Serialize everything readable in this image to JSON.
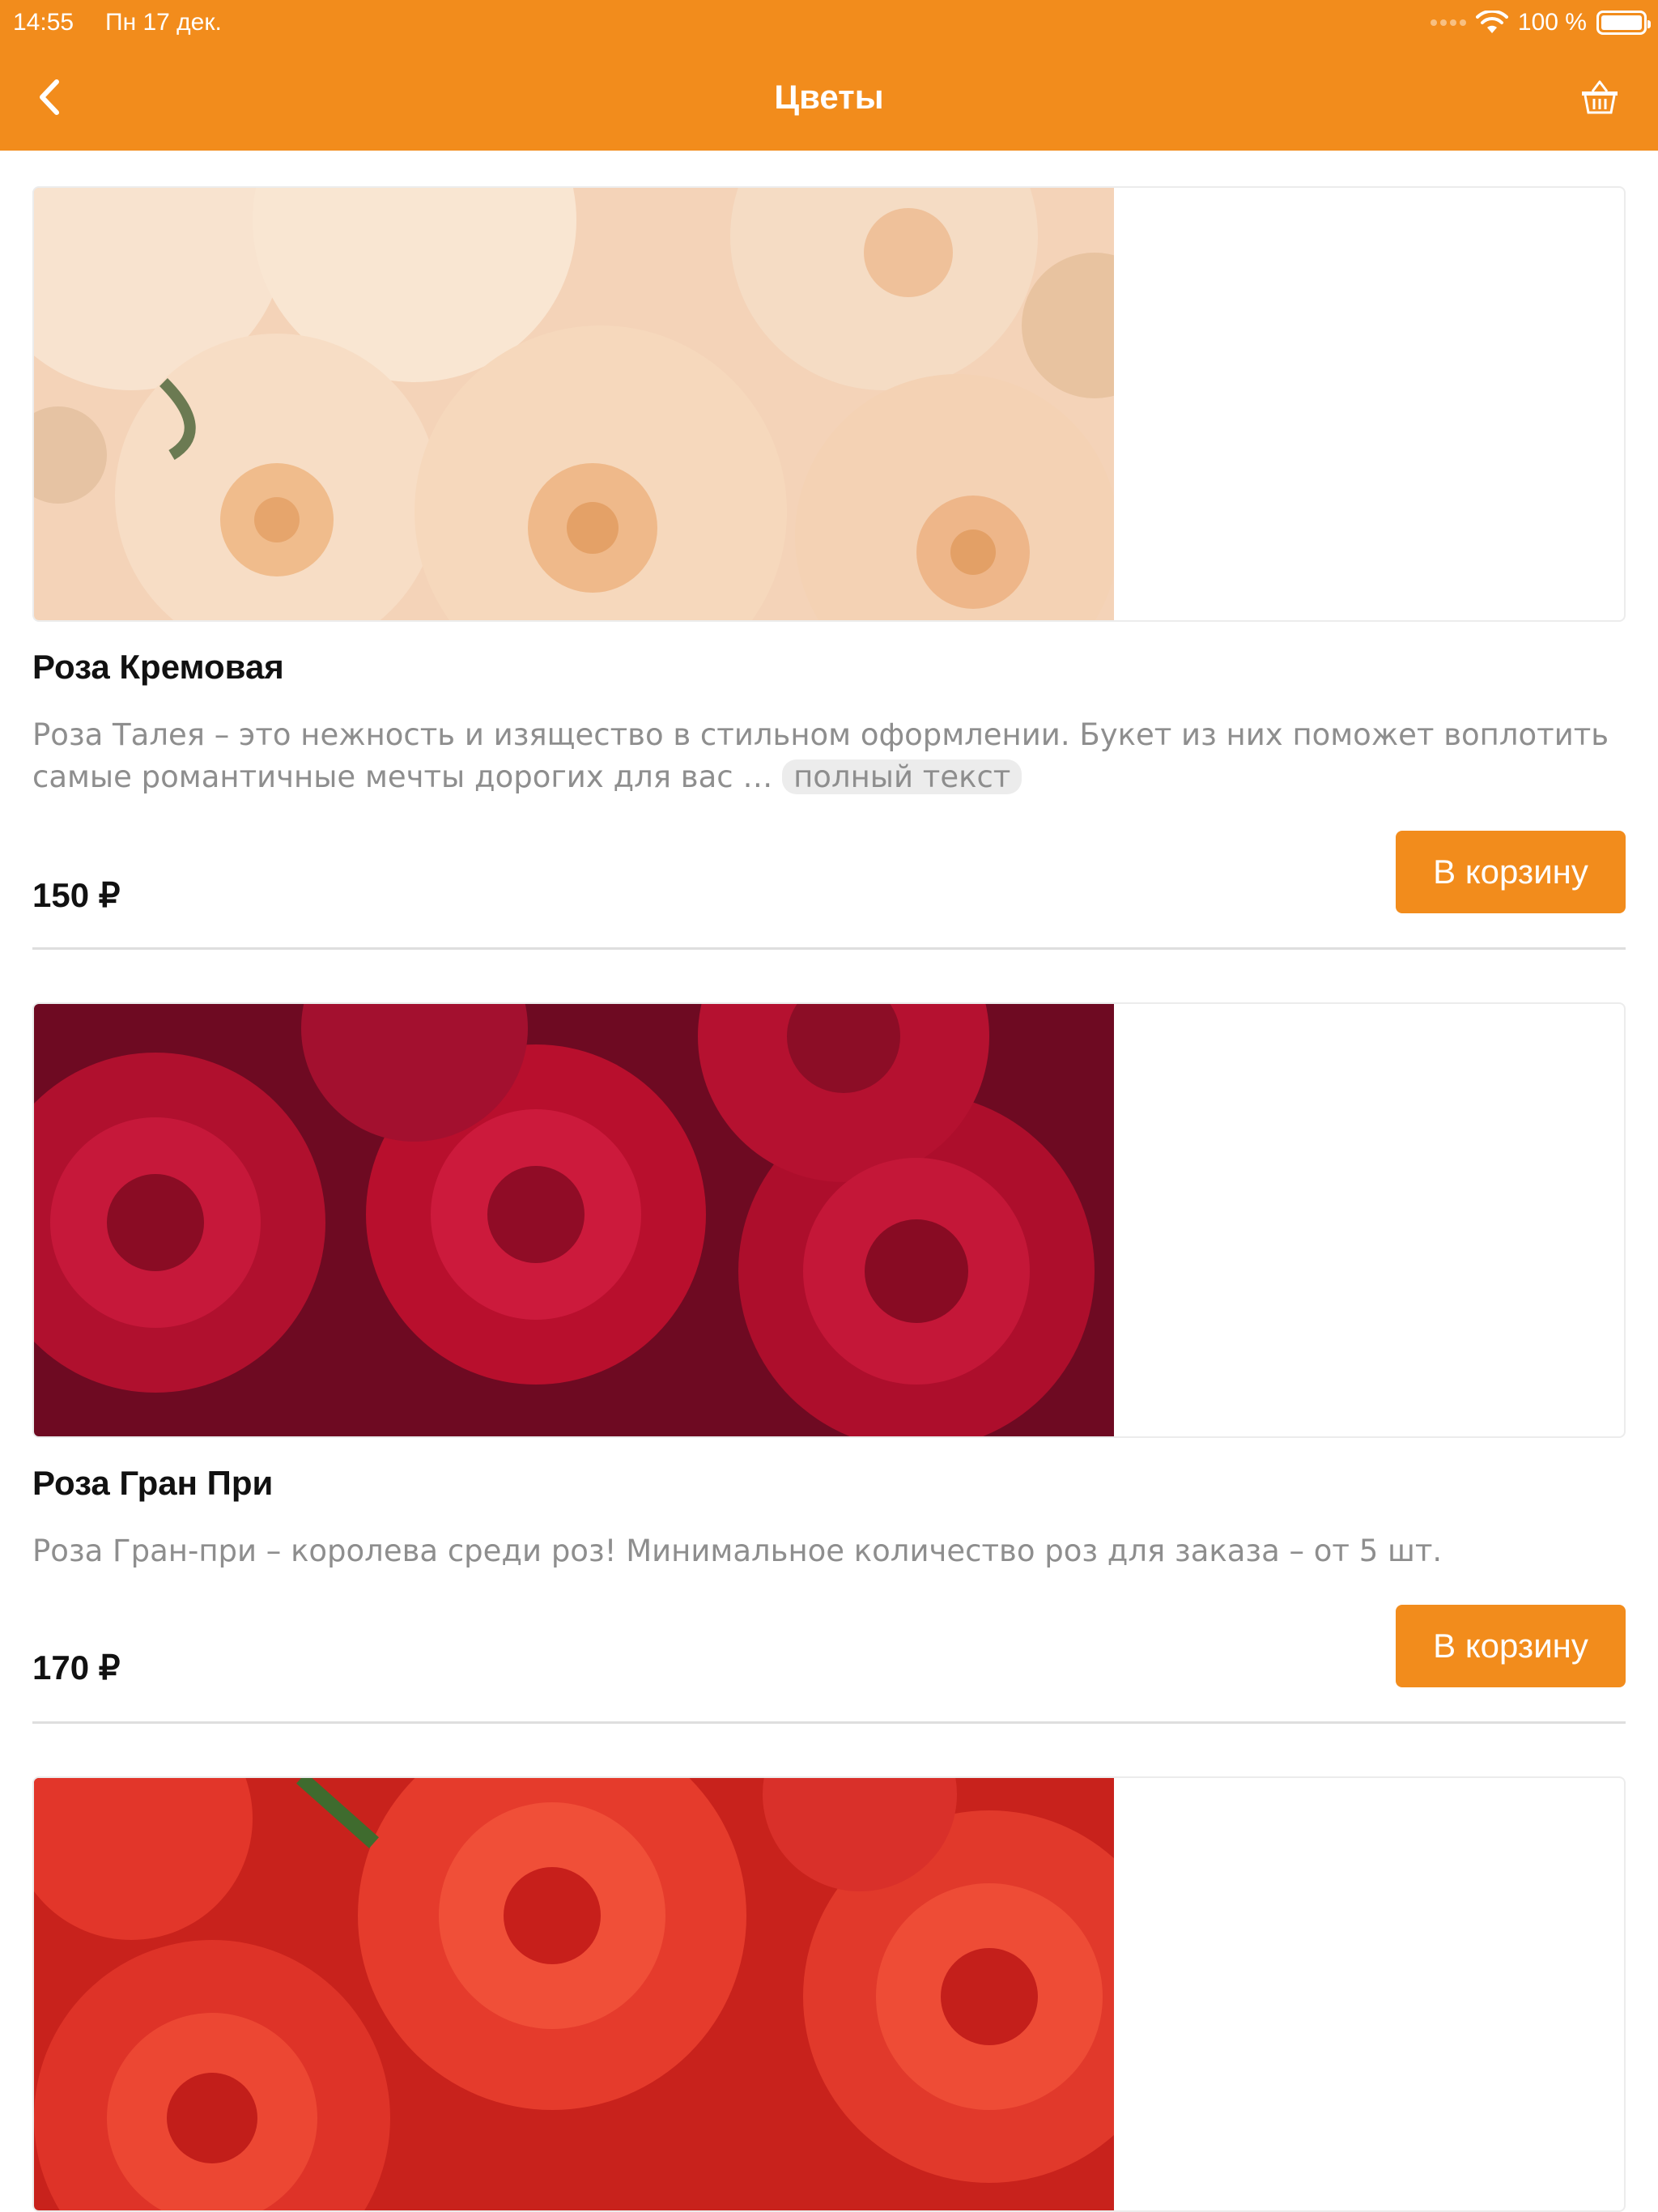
{
  "status_bar": {
    "time": "14:55",
    "date": "Пн 17 дек.",
    "battery_percent": "100 %",
    "icons": [
      "signal-dots-icon",
      "wifi-icon",
      "battery-icon"
    ]
  },
  "nav": {
    "title": "Цветы",
    "back_icon": "chevron-left-icon",
    "cart_icon": "basket-icon"
  },
  "colors": {
    "accent": "#f28c1c",
    "text_primary": "#111111",
    "text_secondary": "#8e8e8e"
  },
  "products": [
    {
      "title": "Роза Кремовая",
      "description": "Роза Талея – это нежность и изящество в стильном оформлении. Букет из них поможет воплотить самые романтичные мечты дорогих для вас …",
      "more_label": "полный текст",
      "price": "150 ₽",
      "button_label": "В корзину",
      "image": "cream-roses-photo"
    },
    {
      "title": "Роза Гран При",
      "description": "Роза Гран-при – королева среди роз!  Минимальное количество роз для заказа – от 5 шт.",
      "price": "170 ₽",
      "button_label": "В корзину",
      "image": "dark-red-roses-photo"
    },
    {
      "image": "red-roses-photo"
    }
  ]
}
